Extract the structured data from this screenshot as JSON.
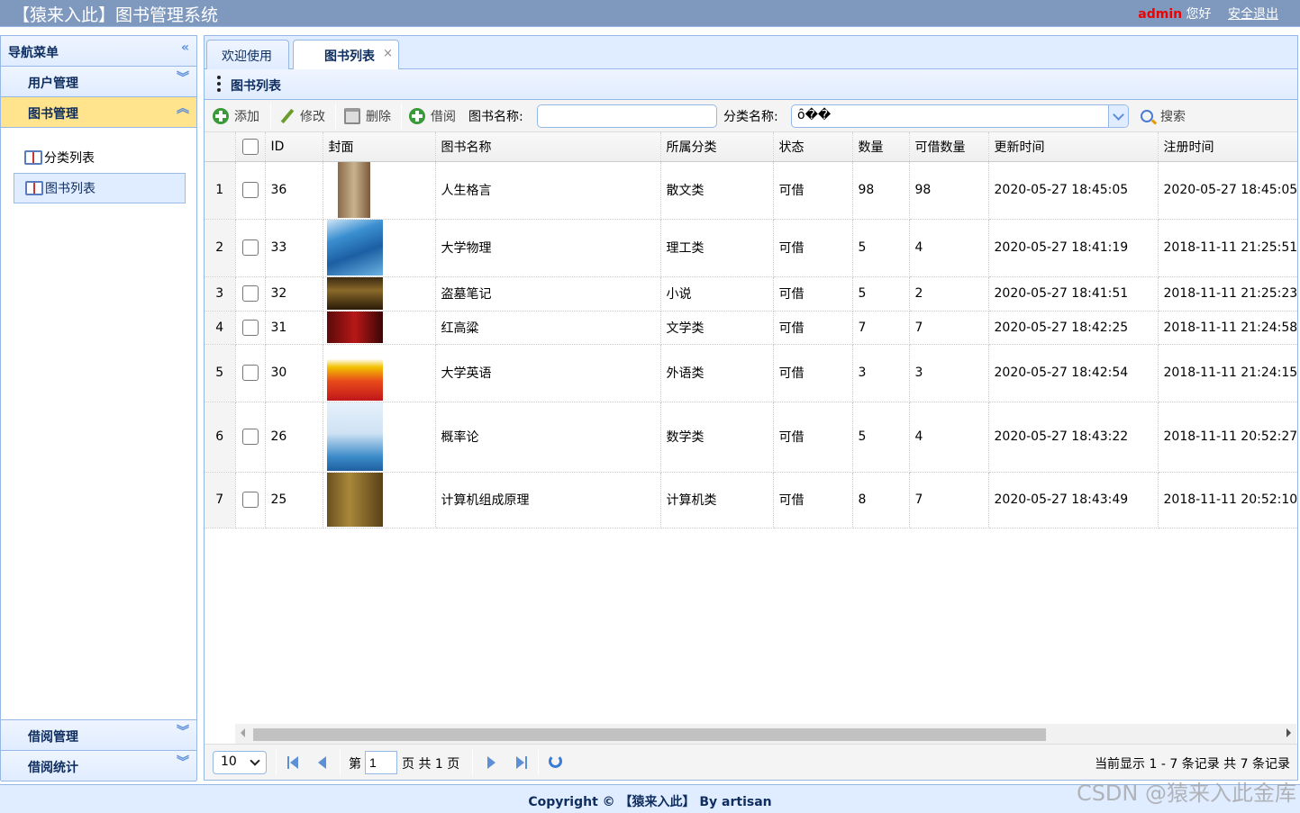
{
  "app": {
    "title": "【猿来入此】图书管理系统",
    "user": "admin",
    "greeting": "您好",
    "logout": "安全退出"
  },
  "sidebar": {
    "title": "导航菜单",
    "groups": [
      {
        "label": "用户管理",
        "expanded": false
      },
      {
        "label": "图书管理",
        "expanded": true
      },
      {
        "label": "借阅管理",
        "expanded": false
      },
      {
        "label": "借阅统计",
        "expanded": false
      }
    ],
    "items": [
      {
        "label": "分类列表",
        "icon": "book-icon",
        "selected": false
      },
      {
        "label": "图书列表",
        "icon": "book-icon",
        "selected": true
      }
    ]
  },
  "tabs": [
    {
      "label": "欢迎使用",
      "active": false
    },
    {
      "label": "图书列表",
      "active": true,
      "close": "×"
    }
  ],
  "panel": {
    "title": "图书列表"
  },
  "toolbar": {
    "add": "添加",
    "edit": "修改",
    "delete": "删除",
    "borrow": "借阅",
    "name_label": "图书名称:",
    "name_value": "",
    "category_label": "分类名称:",
    "category_value": "ȏ��",
    "search": "搜索"
  },
  "table": {
    "columns": [
      "ID",
      "封面",
      "图书名称",
      "所属分类",
      "状态",
      "数量",
      "可借数量",
      "更新时间",
      "注册时间"
    ],
    "rows": [
      {
        "rn": "1",
        "id": "36",
        "cover": "cover-renshengeyan",
        "name": "人生格言",
        "category": "散文类",
        "status": "可借",
        "qty": "98",
        "available": "98",
        "updated": "2020-05-27 18:45:05",
        "registered": "2020-05-27 18:45:05"
      },
      {
        "rn": "2",
        "id": "33",
        "cover": "cover-daxuewuli",
        "name": "大学物理",
        "category": "理工类",
        "status": "可借",
        "qty": "5",
        "available": "4",
        "updated": "2020-05-27 18:41:19",
        "registered": "2018-11-11 21:25:51"
      },
      {
        "rn": "3",
        "id": "32",
        "cover": "cover-daomubiji",
        "name": "盗墓笔记",
        "category": "小说",
        "status": "可借",
        "qty": "5",
        "available": "2",
        "updated": "2020-05-27 18:41:51",
        "registered": "2018-11-11 21:25:23"
      },
      {
        "rn": "4",
        "id": "31",
        "cover": "cover-honggaoliang",
        "name": "红高粱",
        "category": "文学类",
        "status": "可借",
        "qty": "7",
        "available": "7",
        "updated": "2020-05-27 18:42:25",
        "registered": "2018-11-11 21:24:58"
      },
      {
        "rn": "5",
        "id": "30",
        "cover": "cover-daxueyingyu",
        "name": "大学英语",
        "category": "外语类",
        "status": "可借",
        "qty": "3",
        "available": "3",
        "updated": "2020-05-27 18:42:54",
        "registered": "2018-11-11 21:24:15"
      },
      {
        "rn": "6",
        "id": "26",
        "cover": "cover-gailvlun",
        "name": "概率论",
        "category": "数学类",
        "status": "可借",
        "qty": "5",
        "available": "4",
        "updated": "2020-05-27 18:43:22",
        "registered": "2018-11-11 20:52:27"
      },
      {
        "rn": "7",
        "id": "25",
        "cover": "cover-jisuanji",
        "name": "计算机组成原理",
        "category": "计算机类",
        "status": "可借",
        "qty": "8",
        "available": "7",
        "updated": "2020-05-27 18:43:49",
        "registered": "2018-11-11 20:52:10"
      }
    ]
  },
  "pager": {
    "page_size": "10",
    "page_prefix": "第",
    "page_value": "1",
    "page_suffix": "页 共 1 页",
    "info": "当前显示 1 - 7 条记录 共 7 条记录"
  },
  "footer": {
    "copyright": "Copyright © 【猿来入此】 By artisan"
  },
  "watermark": "CSDN @猿来入此金库",
  "colors": {
    "header_bg": "#7f99be",
    "accent": "#95b8e7",
    "active_group": "#ffe48d",
    "username": "#ee0000"
  }
}
